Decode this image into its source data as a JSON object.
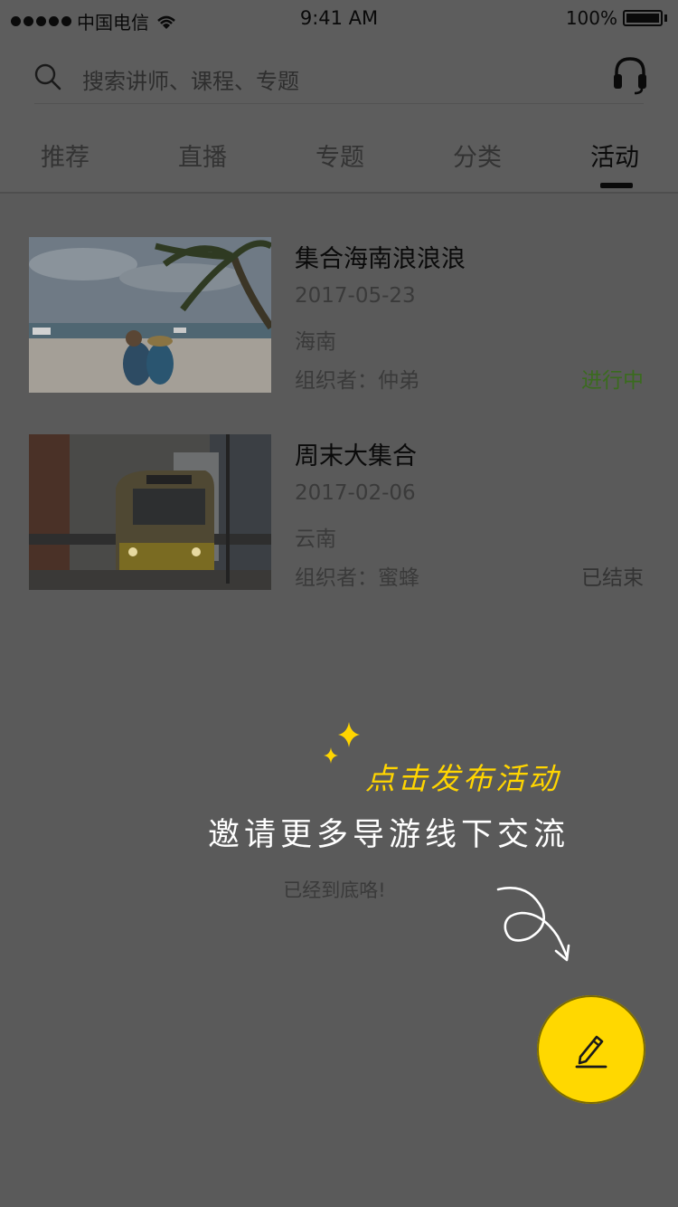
{
  "status_bar": {
    "carrier": "中国电信",
    "time": "9:41 AM",
    "battery": "100%"
  },
  "search": {
    "placeholder": "搜索讲师、课程、专题"
  },
  "tabs": [
    {
      "label": "推荐"
    },
    {
      "label": "直播"
    },
    {
      "label": "专题"
    },
    {
      "label": "分类"
    },
    {
      "label": "活动"
    }
  ],
  "active_tab": "活动",
  "activities": [
    {
      "title": "集合海南浪浪浪",
      "date": "2017-05-23",
      "location": "海南",
      "organizer": "组织者：仲弟",
      "status": "进行中"
    },
    {
      "title": "周末大集合",
      "date": "2017-02-06",
      "location": "云南",
      "organizer": "组织者：蜜蜂",
      "status": "已结束"
    }
  ],
  "footer_tip": "已经到底咯!",
  "promo": {
    "line1": "点击发布活动",
    "line2": "邀请更多导游线下交流"
  },
  "colors": {
    "accent": "#ffd800",
    "ongoing": "#3a6b1e",
    "overlay": "#5a5a5a"
  },
  "icons": {
    "search": "search-icon",
    "service": "headset-icon",
    "publish": "edit-icon"
  }
}
